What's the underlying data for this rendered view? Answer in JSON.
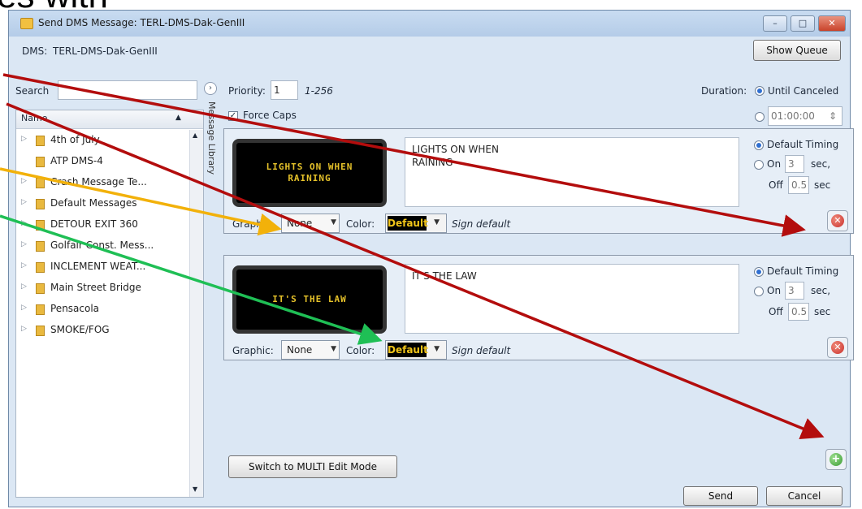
{
  "slide": {
    "heading_fragment": "es with"
  },
  "window": {
    "title": "Send DMS Message: TERL-DMS-Dak-GenIII",
    "controls": {
      "minimize": "–",
      "maximize": "□",
      "close": "✕"
    }
  },
  "dms": {
    "label": "DMS:",
    "value": "TERL-DMS-Dak-GenIII"
  },
  "show_queue": "Show Queue",
  "search": {
    "label": "Search",
    "value": ""
  },
  "library": {
    "expand_glyph": "›",
    "sidebar_label": "Message Library",
    "column_header": "Name",
    "sort_glyph": "▲",
    "items": [
      {
        "label": "4th of July"
      },
      {
        "label": "ATP DMS-4"
      },
      {
        "label": "Crash Message Te..."
      },
      {
        "label": "Default Messages"
      },
      {
        "label": "DETOUR EXIT 360"
      },
      {
        "label": "Golfair Const. Mess..."
      },
      {
        "label": "INCLEMENT WEAT..."
      },
      {
        "label": "Main Street Bridge"
      },
      {
        "label": "Pensacola"
      },
      {
        "label": "SMOKE/FOG"
      }
    ]
  },
  "priority": {
    "label": "Priority:",
    "value": "1",
    "range": "1-256"
  },
  "force_caps": {
    "label": "Force Caps",
    "checked": true
  },
  "duration": {
    "label": "Duration:",
    "until_canceled": "Until Canceled",
    "time_value": "01:00:00",
    "spinner": "⇕"
  },
  "pages": [
    {
      "led_text": "LIGHTS ON WHEN\nRAINING",
      "message_text": "LIGHTS ON WHEN\nRAINING",
      "timing": {
        "default_label": "Default Timing",
        "on_label": "On",
        "on_value": "3",
        "on_unit": "sec,",
        "off_label": "Off",
        "off_value": "0.5",
        "off_unit": "sec"
      },
      "graphic_label": "Graphic:",
      "graphic_value": "None",
      "color_label": "Color:",
      "color_value": "Default",
      "sign_default": "Sign default"
    },
    {
      "led_text": "IT'S THE LAW",
      "message_text": "IT'S THE LAW",
      "timing": {
        "default_label": "Default Timing",
        "on_label": "On",
        "on_value": "3",
        "on_unit": "sec,",
        "off_label": "Off",
        "off_value": "0.5",
        "off_unit": "sec"
      },
      "graphic_label": "Graphic:",
      "graphic_value": "None",
      "color_label": "Color:",
      "color_value": "Default",
      "sign_default": "Sign default"
    }
  ],
  "buttons": {
    "multi_edit": "Switch to MULTI Edit Mode",
    "send": "Send",
    "cancel": "Cancel",
    "delete_glyph": "✕",
    "add_glyph": "+"
  },
  "colors": {
    "arrow_red": "#b30d0d",
    "arrow_orange": "#f2b10a",
    "arrow_green": "#1fbf55",
    "led_amber": "#e6c22a"
  }
}
